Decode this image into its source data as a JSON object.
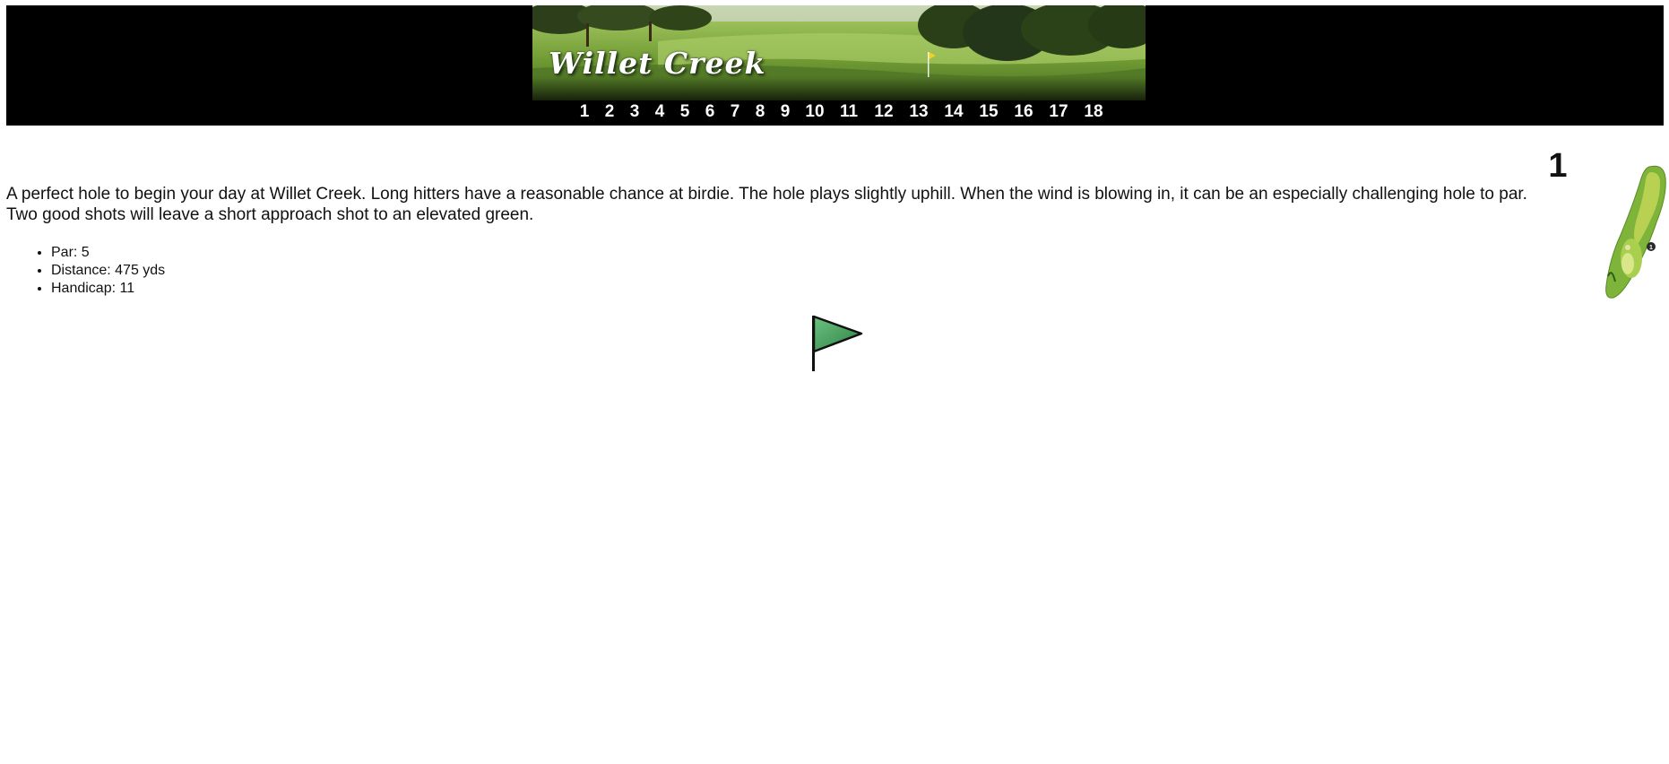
{
  "header": {
    "course_name": "Willet Creek",
    "holes": [
      "1",
      "2",
      "3",
      "4",
      "5",
      "6",
      "7",
      "8",
      "9",
      "10",
      "11",
      "12",
      "13",
      "14",
      "15",
      "16",
      "17",
      "18"
    ]
  },
  "hole": {
    "number": "1",
    "description": "A perfect hole to begin your day at Willet Creek. Long hitters have a reasonable chance at birdie. The hole plays slightly uphill. When the wind is blowing in, it can be an especially challenging hole to par. Two good shots will leave a short approach shot to an elevated green.",
    "stats": [
      "Par: 5",
      "Distance: 475 yds",
      "Handicap: 11"
    ]
  },
  "icons": {
    "flag": "flag-icon",
    "hole_map": "hole-map-icon"
  },
  "colors": {
    "header_bg": "#000000",
    "nav_text": "#ffffff",
    "flag_green": "#3f9a55",
    "fairway_green": "#7fb43a"
  }
}
